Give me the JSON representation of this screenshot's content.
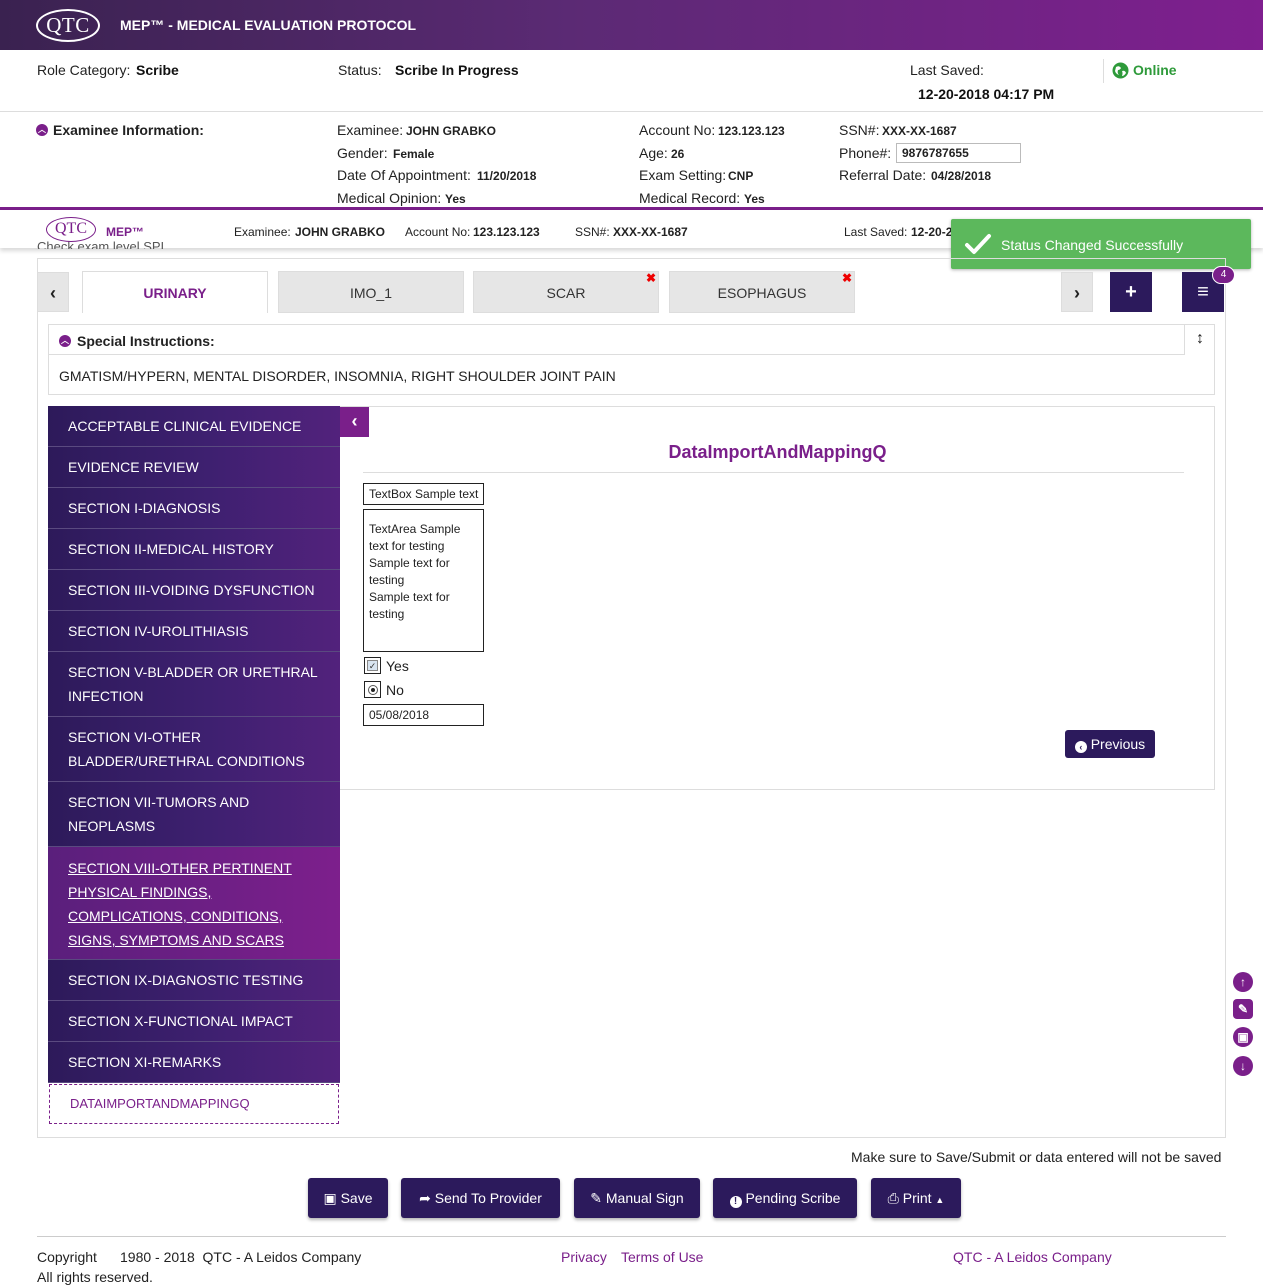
{
  "header": {
    "logo": "QTC",
    "title": "MEP™ - MEDICAL EVALUATION PROTOCOL"
  },
  "status_bar": {
    "role_label": "Role Category:",
    "role_value": "Scribe",
    "status_label": "Status:",
    "status_value": "Scribe In Progress",
    "last_saved_label": "Last Saved:",
    "last_saved_value": "12-20-2018 04:17 PM",
    "online_label": "Online",
    "online_color": "#2e9a3a"
  },
  "examinee": {
    "section_title": "Examinee Information:",
    "examinee_label": "Examinee:",
    "examinee_value": "JOHN GRABKO",
    "gender_label": "Gender:",
    "gender_value": "Female",
    "doa_label": "Date Of Appointment:",
    "doa_value": "11/20/2018",
    "opinion_label": "Medical Opinion:",
    "opinion_value": "Yes",
    "account_label": "Account No:",
    "account_value": "123.123.123",
    "age_label": "Age:",
    "age_value": "26",
    "exam_setting_label": "Exam Setting:",
    "exam_setting_value": "CNP",
    "medical_record_label": "Medical Record:",
    "medical_record_value": "Yes",
    "ssn_label": "SSN#:",
    "ssn_value": "XXX-XX-1687",
    "phone_label": "Phone#:",
    "phone_value": "9876787655",
    "referral_label": "Referral Date:",
    "referral_value": "04/28/2018"
  },
  "sticky": {
    "logo": "QTC",
    "brand": "MEP™",
    "examinee_label": "Examinee:",
    "examinee_value": "JOHN GRABKO",
    "account_label": "Account No:",
    "account_value": "123.123.123",
    "ssn_label": "SSN#:",
    "ssn_value": "XXX-XX-1687",
    "last_saved_label": "Last Saved:",
    "last_saved_value": "12-20-2",
    "hidden_text": "Check exam level SPI"
  },
  "toast": {
    "message": "Status Changed Successfully",
    "color": "#5cb85c"
  },
  "tabs": {
    "items": [
      {
        "label": "URINARY",
        "active": true,
        "closable": false
      },
      {
        "label": "IMO_1",
        "active": false,
        "closable": false
      },
      {
        "label": "SCAR",
        "active": false,
        "closable": true
      },
      {
        "label": "ESOPHAGUS",
        "active": false,
        "closable": true
      }
    ],
    "close_glyph": "✖",
    "prev_glyph": "‹",
    "next_glyph": "›",
    "add_glyph": "+",
    "menu_glyph": "≡",
    "badge_count": "4"
  },
  "special_instructions": {
    "title": "Special Instructions:",
    "text": "GMATISM/HYPERN, MENTAL DISORDER, INSOMNIA, RIGHT SHOULDER JOINT PAIN"
  },
  "sidebar": {
    "items": [
      "ACCEPTABLE CLINICAL EVIDENCE",
      "EVIDENCE REVIEW",
      "SECTION I-DIAGNOSIS",
      "SECTION II-MEDICAL HISTORY",
      "SECTION III-VOIDING DYSFUNCTION",
      "SECTION IV-UROLITHIASIS",
      "SECTION V-BLADDER OR URETHRAL INFECTION",
      "SECTION VI-OTHER BLADDER/URETHRAL CONDITIONS",
      "SECTION VII-TUMORS AND NEOPLASMS",
      "SECTION VIII-OTHER PERTINENT PHYSICAL FINDINGS, COMPLICATIONS, CONDITIONS, SIGNS, SYMPTOMS AND SCARS",
      "SECTION IX-DIAGNOSTIC TESTING",
      "SECTION X-FUNCTIONAL IMPACT",
      "SECTION XI-REMARKS",
      "DATAIMPORTANDMAPPINGQ"
    ],
    "active_index": 9
  },
  "form": {
    "title": "DataImportAndMappingQ",
    "textbox_value": "TextBox Sample text",
    "textarea_value": "TextArea Sample text for testing\nSample text for testing\nSample text for testing",
    "checkbox_label": "Yes",
    "radio_label": "No",
    "date_value": "05/08/2018",
    "previous_label": "Previous"
  },
  "actions": {
    "note": "Make sure to Save/Submit or data entered will not be saved",
    "save": "Save",
    "send": "Send To Provider",
    "manual_sign": "Manual Sign",
    "pending": "Pending Scribe",
    "print": "Print"
  },
  "footer": {
    "copyright": "Copyright",
    "years": "1980 - 2018  QTC - A Leidos Company",
    "rights": "All rights reserved.",
    "privacy": "Privacy",
    "terms": "Terms of Use",
    "company_link": "QTC - A Leidos Company"
  },
  "colors": {
    "brand_purple": "#7a1f8a",
    "navy": "#2c1a5c"
  }
}
